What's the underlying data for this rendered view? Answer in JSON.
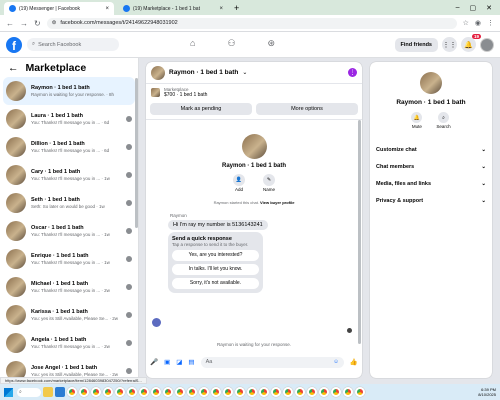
{
  "browser": {
    "tabs": [
      {
        "title": "(19) Messenger | Facebook",
        "active": true
      },
      {
        "title": "(19) Marketplace - 1 bed 1 bat",
        "active": false
      }
    ],
    "new_tab": "+",
    "url": "facebook.com/messages/t/24149622948031902",
    "status_url": "https://www.facebook.com/marketplace/item/1284603983047250/?referralS..."
  },
  "fb_header": {
    "logo": "f",
    "search_placeholder": "Search Facebook",
    "find_friends": "Find friends",
    "notification_badge": "19"
  },
  "sidebar": {
    "title": "Marketplace",
    "items": [
      {
        "name": "Raymon · 1 bed 1 bath",
        "preview": "Raymon is waiting for your response. · 8h",
        "active": true
      },
      {
        "name": "Laura · 1 bed 1 bath",
        "preview": "You: Thanks! I'll message you in ... · 6d"
      },
      {
        "name": "Dillion · 1 bed 1 bath",
        "preview": "You: Thanks! I'll message you in ... · 6d"
      },
      {
        "name": "Cary · 1 bed 1 bath",
        "preview": "You: Thanks! I'll message you in ... · 1w"
      },
      {
        "name": "Seth · 1 bed 1 bath",
        "preview": "Seth: So later on would be good · 1w"
      },
      {
        "name": "Oscar · 1 bed 1 bath",
        "preview": "You: Thanks! I'll message you in ... · 1w"
      },
      {
        "name": "Enrique · 1 bed 1 bath",
        "preview": "You: Thanks! I'll message you in ... · 1w"
      },
      {
        "name": "Michael · 1 bed 1 bath",
        "preview": "You: Thanks! I'll message you in ... · 2w"
      },
      {
        "name": "Karissa · 1 bed 1 bath",
        "preview": "You: yes its Still Available, Please Se... · 2w"
      },
      {
        "name": "Angela · 1 bed 1 bath",
        "preview": "You: Thanks! I'll message you in ... · 2w"
      },
      {
        "name": "Jose Angel · 1 bed 1 bath",
        "preview": "You: yes its Still Available, Please Se... · 2w"
      }
    ]
  },
  "chat": {
    "title": "Raymon · 1 bed 1 bath",
    "listing_sub": "Marketplace",
    "listing_main": "$700 · 1 bed 1 bath",
    "mark_pending": "Mark as pending",
    "more_options": "More options",
    "center_title": "Raymon · 1 bed 1 bath",
    "add_label": "Add",
    "name_label": "Name",
    "started_text": "Raymon started this chat.",
    "view_profile": "View buyer profile",
    "sender": "Raymon",
    "message": "Hi I'm ray my number is 5136143241",
    "quick_title": "Send a quick response",
    "quick_sub": "Tap a response to send it to the buyer.",
    "quick_options": [
      "Yes, are you interested?",
      "In talks. I'll let you know.",
      "Sorry, it's not available."
    ],
    "waiting": "Raymon is waiting for your response.",
    "composer_placeholder": "Aa"
  },
  "right_panel": {
    "name": "Raymon · 1 bed 1 bath",
    "mute": "Mute",
    "search": "Search",
    "rows": [
      "Customize chat",
      "Chat members",
      "Media, files and links",
      "Privacy & support"
    ]
  },
  "taskbar": {
    "time": "6:39 PM",
    "date": "8/10/2025"
  }
}
